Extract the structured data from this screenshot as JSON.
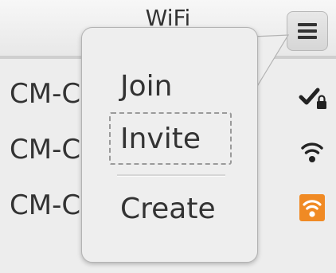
{
  "window": {
    "title": "WiFi"
  },
  "header": {
    "menu_icon": "hamburger-menu-icon"
  },
  "networks": [
    {
      "name": "CM-C",
      "icon": "connected-lock-icon",
      "status_color": "#222222"
    },
    {
      "name": "CM-C",
      "icon": "wifi-signal-icon",
      "status_color": "#222222"
    },
    {
      "name": "CM-C",
      "icon": "wifi-signal-icon",
      "status_color": "#f08a24"
    }
  ],
  "menu": {
    "items": [
      {
        "label": "Join"
      },
      {
        "label": "Invite",
        "focused": true
      },
      {
        "label": "Create"
      }
    ]
  },
  "colors": {
    "accent_orange": "#f08a24",
    "background": "#ededed",
    "text": "#333333"
  }
}
